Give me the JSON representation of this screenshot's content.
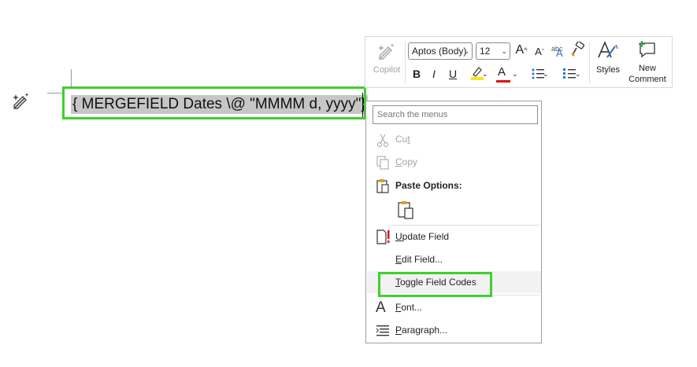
{
  "document": {
    "field_code": "{ MERGEFIELD Dates \\@ \"MMMM d, yyyy\"}"
  },
  "mini_toolbar": {
    "copilot_label": "Copilot",
    "font_name": "Aptos (Body)",
    "font_size": "12",
    "grow_font": "A",
    "shrink_font": "A",
    "clear_format": "abc",
    "bold": "B",
    "italic": "I",
    "underline": "U",
    "font_color_glyph": "A",
    "styles_label": "Styles",
    "new_comment_label": "New Comment",
    "highlight_color": "#f5e61a",
    "font_color": "#e01010"
  },
  "context_menu": {
    "search_placeholder": "Search the menus",
    "items": [
      {
        "label": "Cut",
        "underline": "t",
        "disabled": true
      },
      {
        "label": "Copy",
        "underline": "C",
        "disabled": true
      },
      {
        "label": "Paste Options:",
        "disabled": false
      },
      {
        "label": "Update Field",
        "underline": "U",
        "disabled": false
      },
      {
        "label": "Edit Field...",
        "underline": "E",
        "disabled": false
      },
      {
        "label": "Toggle Field Codes",
        "underline": "T",
        "disabled": false
      },
      {
        "label": "Font...",
        "underline": "F",
        "disabled": false
      },
      {
        "label": "Paragraph...",
        "underline": "P",
        "disabled": false
      }
    ]
  },
  "colors": {
    "highlight_box": "#3ed12b",
    "field_shading": "#c6c6c6",
    "menu_hover": "#f2f2f2"
  }
}
